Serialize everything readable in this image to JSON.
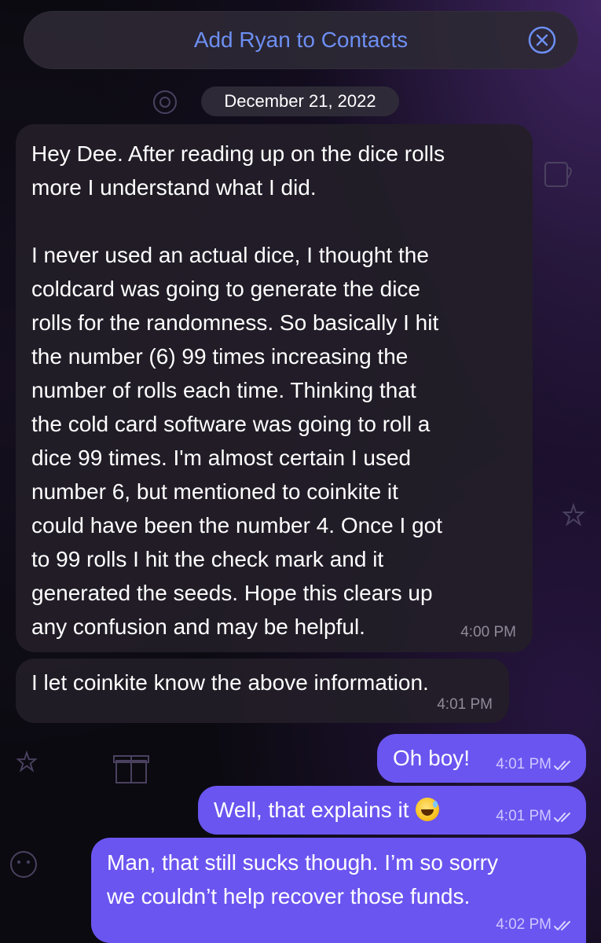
{
  "banner": {
    "text": "Add Ryan to Contacts"
  },
  "date_separator": "December 21, 2022",
  "messages": [
    {
      "direction": "incoming",
      "text": "Hey Dee. After reading up on the dice rolls\nmore I understand what I did.\n\nI never used an actual dice, I thought the\ncoldcard was going to generate the dice\nrolls for the randomness. So basically I hit\nthe number (6) 99 times increasing the\nnumber of rolls each time. Thinking that\nthe cold card software was going to roll a\ndice 99 times. I'm almost certain I used\nnumber 6, but mentioned to coinkite it\ncould have been the number 4. Once I got\nto 99 rolls I hit the check mark and it\ngenerated the seeds. Hope this clears up\nany confusion and may be helpful.",
      "time": "4:00 PM"
    },
    {
      "direction": "incoming",
      "text": "I let coinkite know the above information.",
      "time": "4:01 PM"
    },
    {
      "direction": "outgoing",
      "text": "Oh boy!",
      "time": "4:01 PM",
      "status": "read-double-check"
    },
    {
      "direction": "outgoing",
      "text": "Well, that explains it",
      "emoji": "sweat-smile-emoji",
      "time": "4:01 PM",
      "status": "read-double-check"
    },
    {
      "direction": "outgoing",
      "text": "Man, that still sucks though. I’m so sorry\nwe couldn’t help recover those funds.",
      "time": "4:02 PM",
      "status": "read-double-check"
    }
  ],
  "colors": {
    "outgoing_bubble": "#6a55f0",
    "incoming_bubble": "#221e28",
    "banner_text": "#6d8ff2"
  }
}
